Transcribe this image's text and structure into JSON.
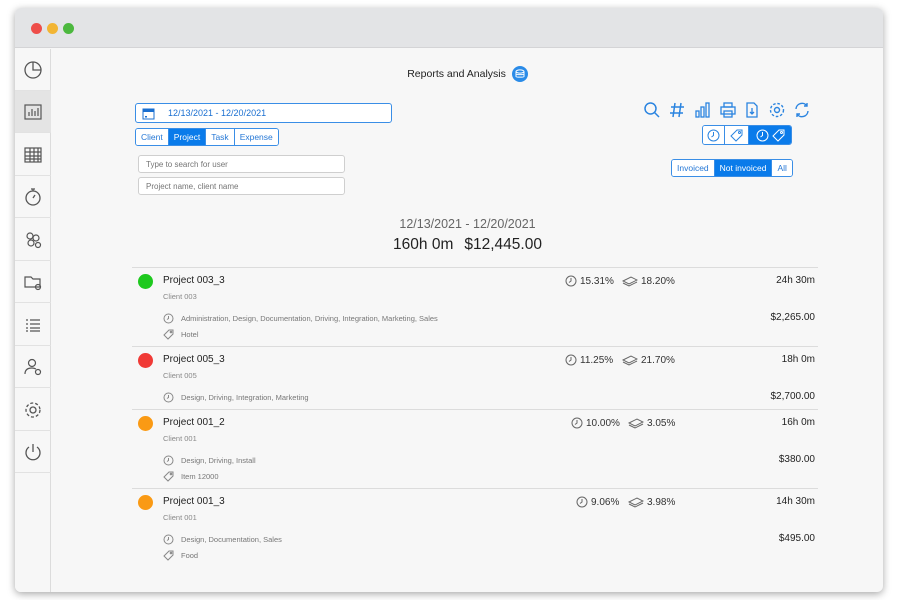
{
  "header": {
    "title": "Reports and Analysis",
    "title_icon": "database-icon"
  },
  "sidebar": {
    "items": [
      {
        "name": "pie-chart-icon",
        "active": false
      },
      {
        "name": "bar-chart-icon",
        "active": true
      },
      {
        "name": "grid-table-icon",
        "active": false
      },
      {
        "name": "stopwatch-icon",
        "active": false
      },
      {
        "name": "team-settings-icon",
        "active": false
      },
      {
        "name": "folder-settings-icon",
        "active": false
      },
      {
        "name": "list-icon",
        "active": false
      },
      {
        "name": "user-settings-icon",
        "active": false
      },
      {
        "name": "gear-icon",
        "active": false
      },
      {
        "name": "power-icon",
        "active": false
      }
    ]
  },
  "filters": {
    "date_range": "12/13/2021 - 12/20/2021",
    "type_tabs": [
      "Client",
      "Project",
      "Task",
      "Expense"
    ],
    "type_selected": "Project",
    "user_search_placeholder": "Type to search for user",
    "project_search_placeholder": "Project name, client name",
    "invoice_tabs": [
      "Invoiced",
      "Not invoiced",
      "All"
    ],
    "invoice_selected": "Not invoiced"
  },
  "toolbar": {
    "icons": [
      "search-icon",
      "hash-icon",
      "bar-chart-icon",
      "print-icon",
      "export-icon",
      "gear-icon",
      "refresh-icon"
    ],
    "view_toggles": [
      "clock-icon",
      "tag-icon",
      "clock-tag-icon"
    ],
    "view_selected": "clock-tag-icon"
  },
  "summary": {
    "range": "12/13/2021 - 12/20/2021",
    "total_time": "160h 0m",
    "total_amount": "$12,445.00"
  },
  "colors": {
    "accent": "#0a7bea",
    "green": "#1ec91e",
    "red": "#f03a36",
    "orange": "#fa9a14"
  },
  "projects": [
    {
      "name": "Project 003_3",
      "client": "Client 003",
      "color": "#1ec91e",
      "time_pct": "15.31%",
      "money_pct": "18.20%",
      "time": "24h 30m",
      "amount": "$2,265.00",
      "tasks": "Administration, Design, Documentation, Driving, Integration, Marketing, Sales",
      "expenses": "Hotel"
    },
    {
      "name": "Project 005_3",
      "client": "Client 005",
      "color": "#f03a36",
      "time_pct": "11.25%",
      "money_pct": "21.70%",
      "time": "18h 0m",
      "amount": "$2,700.00",
      "tasks": "Design, Driving, Integration, Marketing",
      "expenses": ""
    },
    {
      "name": "Project 001_2",
      "client": "Client 001",
      "color": "#fa9a14",
      "time_pct": "10.00%",
      "money_pct": "3.05%",
      "time": "16h 0m",
      "amount": "$380.00",
      "tasks": "Design, Driving, Install",
      "expenses": "Item 12000"
    },
    {
      "name": "Project 001_3",
      "client": "Client 001",
      "color": "#fa9a14",
      "time_pct": "9.06%",
      "money_pct": "3.98%",
      "time": "14h 30m",
      "amount": "$495.00",
      "tasks": "Design, Documentation, Sales",
      "expenses": "Food"
    }
  ]
}
